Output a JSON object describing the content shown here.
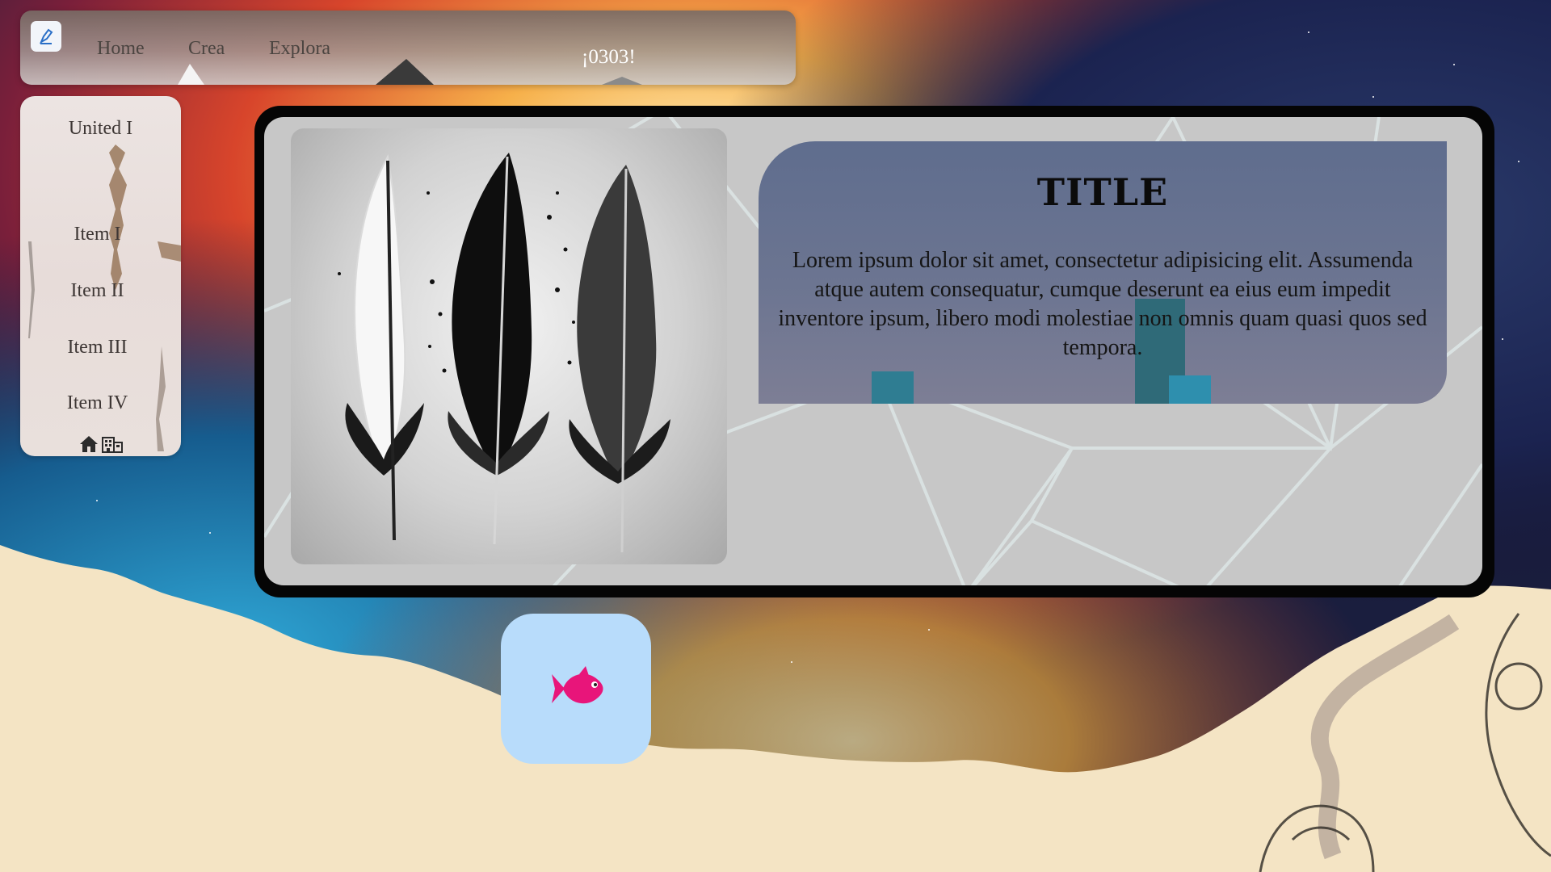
{
  "topbar": {
    "logo_icon": "pen-icon",
    "nav": [
      "Home",
      "Crea",
      "Explora"
    ],
    "title": "¡0303!"
  },
  "sidebar": {
    "title": "United I",
    "items": [
      "Item I",
      "Item II",
      "Item III",
      "Item IV"
    ],
    "icons": [
      "home-icon",
      "building-icon"
    ]
  },
  "card": {
    "image_icon": "feathers-illustration",
    "title": "TITLE",
    "body": "Lorem ipsum dolor sit amet, consectetur adipisicing elit. Assumenda atque autem consequatur, cumque deserunt ea eius eum impedit inventore ipsum, libero modi molestiae non omnis quam quasi quos sed tempora."
  },
  "fish_button": {
    "icon": "fish-icon",
    "color": "#e8157a",
    "background": "#b8dcfb"
  },
  "colors": {
    "frame": "#050505",
    "card": "#c7c7c7",
    "panel": "#66708f"
  }
}
